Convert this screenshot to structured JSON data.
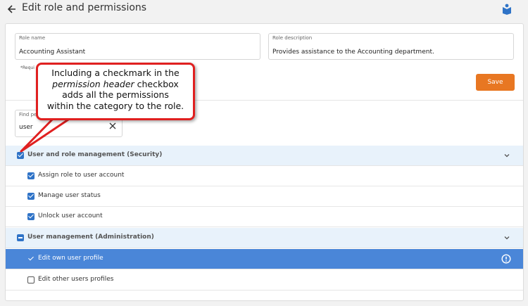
{
  "header": {
    "title": "Edit role and permissions"
  },
  "form": {
    "role_name_label": "Role name",
    "role_name_value": "Accounting Assistant",
    "role_desc_label": "Role description",
    "role_desc_value": "Provides assistance to the Accounting department.",
    "required_note": "*Requi",
    "save_label": "Save"
  },
  "search": {
    "label": "Find per",
    "value": "user"
  },
  "permissions": {
    "security_header": "User and role management (Security)",
    "security_items": [
      "Assign role to user account",
      "Manage user status",
      "Unlock user account"
    ],
    "admin_header": "User management (Administration)",
    "admin_items": [
      "Edit own user profile",
      "Edit other users profiles"
    ]
  },
  "callout": {
    "line1": "Including a checkmark in the",
    "line2_italic": "permission header",
    "line2_rest": " checkbox",
    "line3": "adds all the permissions",
    "line4": "within the category to the role."
  },
  "colors": {
    "accent": "#e87722",
    "selected_row": "#4a86d8",
    "header_row": "#e8f2fb",
    "checkbox": "#2f73c7",
    "callout_border": "#e02020"
  },
  "icons": {
    "back": "arrow-left-icon",
    "help": "book-help-icon",
    "clear": "close-icon",
    "chevron": "chevron-down-icon",
    "alert": "alert-circle-icon"
  }
}
